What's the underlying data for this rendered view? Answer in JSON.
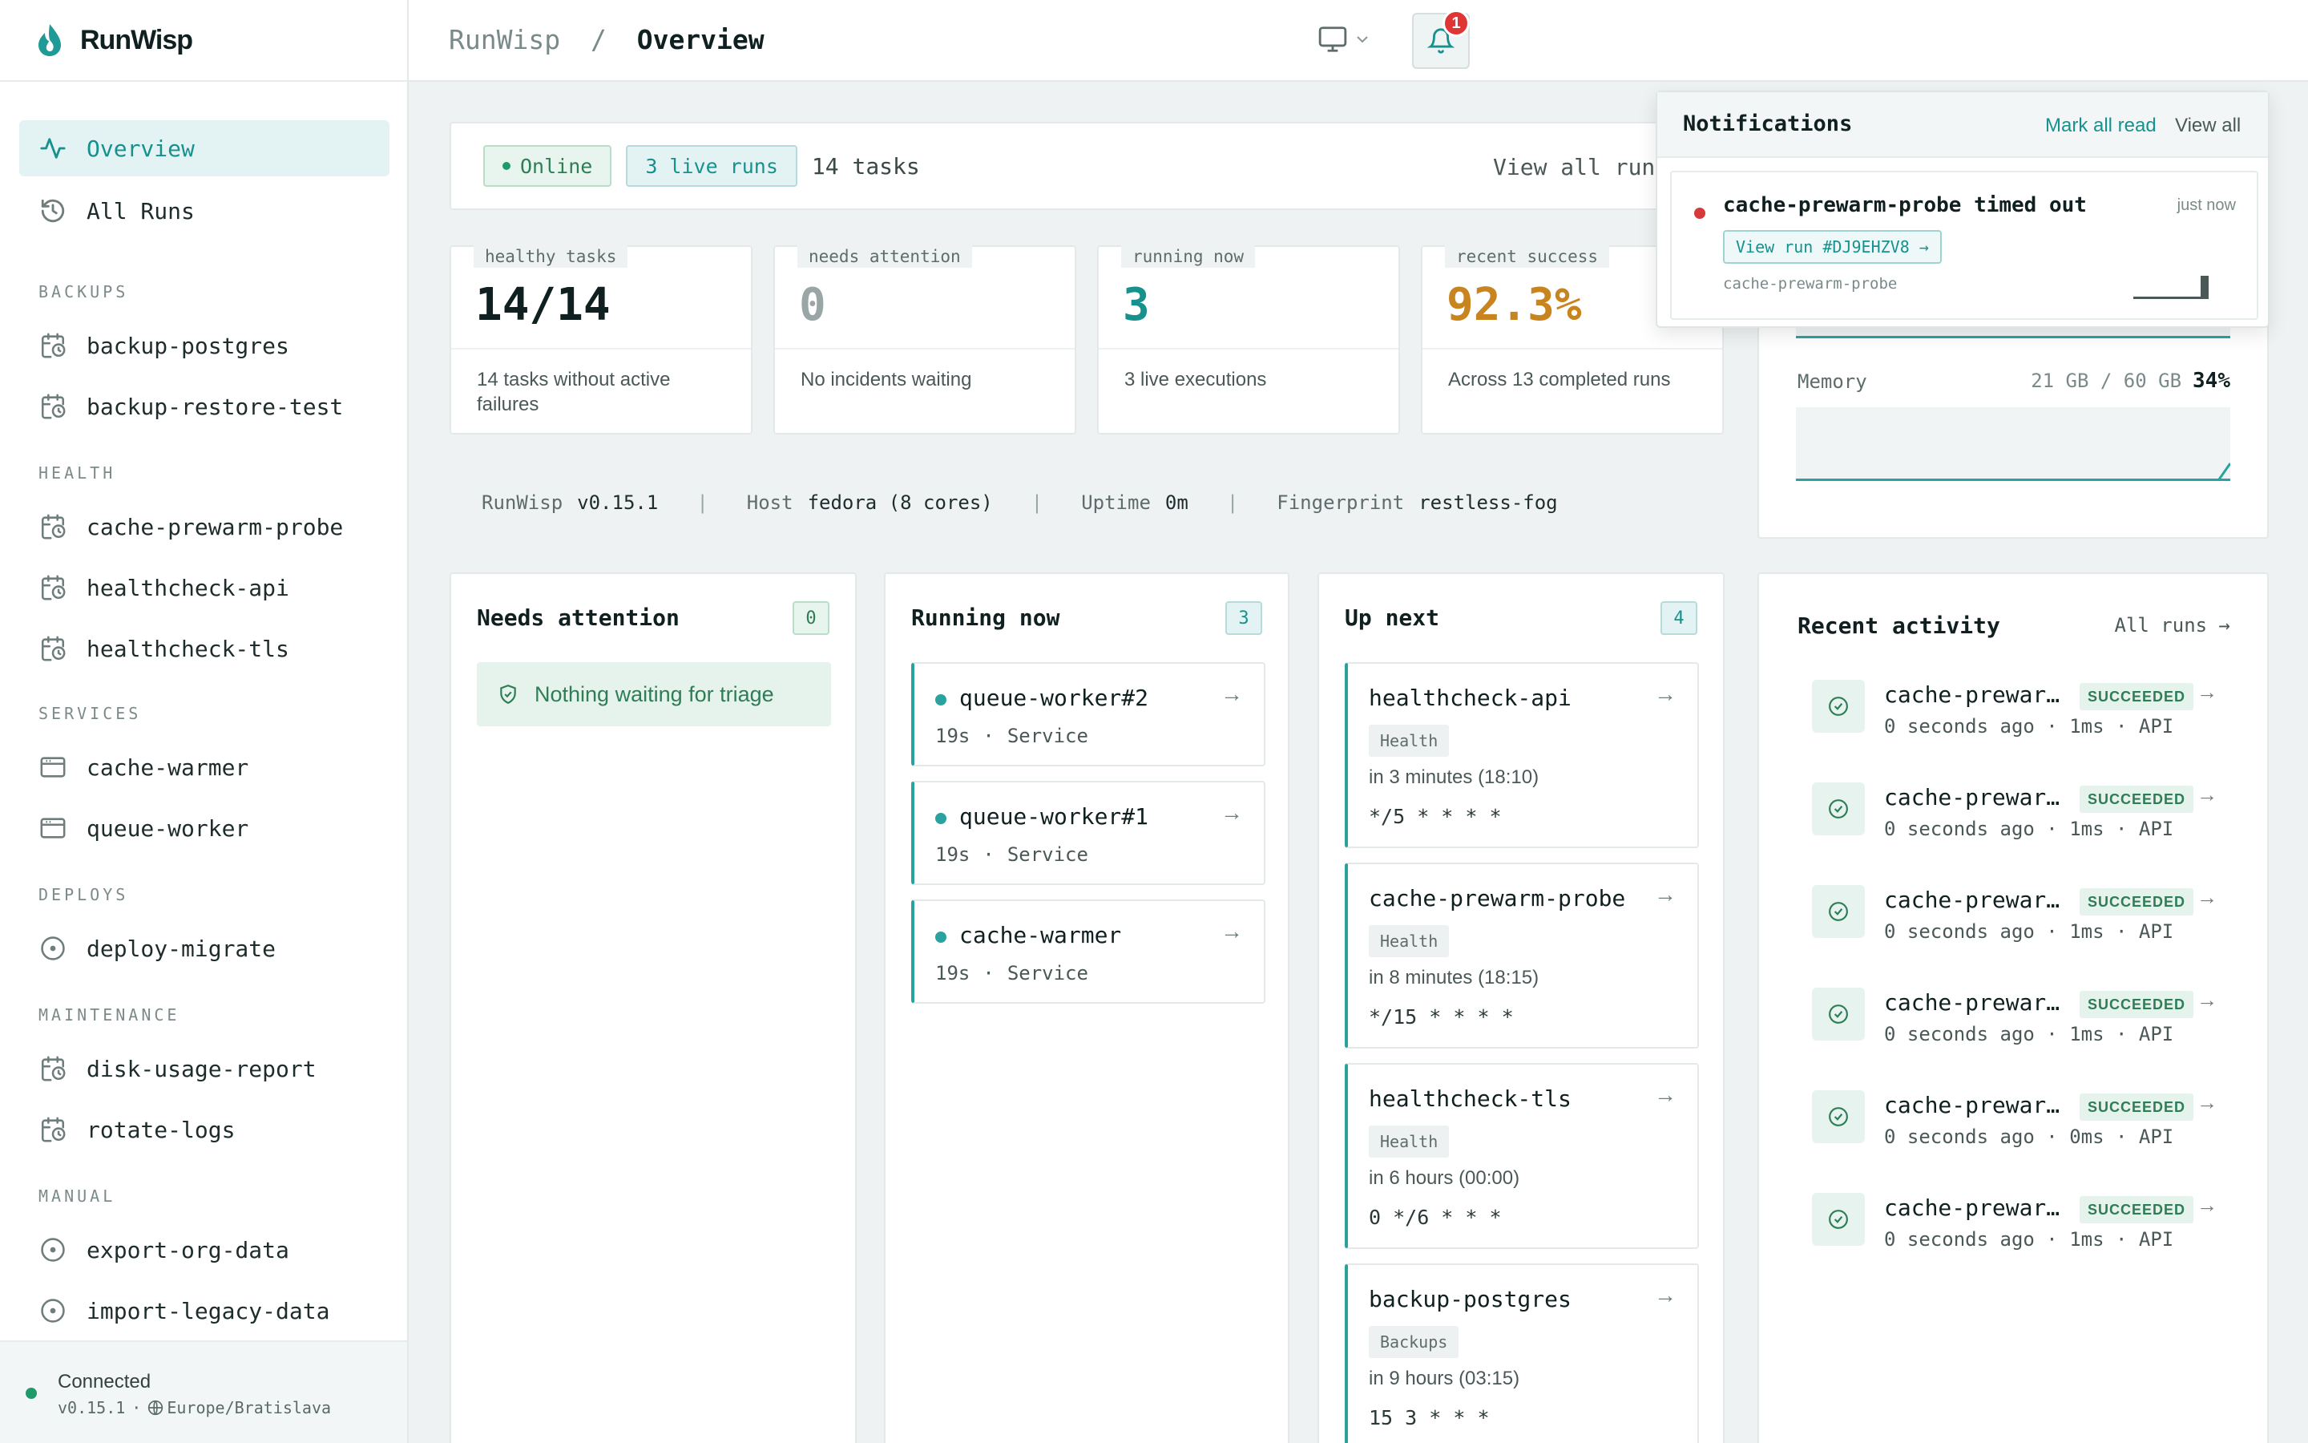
{
  "brand": {
    "name": "RunWisp"
  },
  "breadcrumb": {
    "root": "RunWisp",
    "sep": "/",
    "current": "Overview"
  },
  "sidebar": {
    "nav": [
      {
        "label": "Overview",
        "icon": "activity-icon",
        "active": true
      },
      {
        "label": "All Runs",
        "icon": "history-icon",
        "active": false
      }
    ],
    "groups": [
      {
        "title": "BACKUPS",
        "items": [
          {
            "label": "backup-postgres",
            "icon": "calendar-clock-icon"
          },
          {
            "label": "backup-restore-test",
            "icon": "calendar-clock-icon"
          }
        ]
      },
      {
        "title": "HEALTH",
        "items": [
          {
            "label": "cache-prewarm-probe",
            "icon": "calendar-clock-icon"
          },
          {
            "label": "healthcheck-api",
            "icon": "calendar-clock-icon"
          },
          {
            "label": "healthcheck-tls",
            "icon": "calendar-clock-icon"
          }
        ]
      },
      {
        "title": "SERVICES",
        "items": [
          {
            "label": "cache-warmer",
            "icon": "window-icon"
          },
          {
            "label": "queue-worker",
            "icon": "window-icon"
          }
        ]
      },
      {
        "title": "DEPLOYS",
        "items": [
          {
            "label": "deploy-migrate",
            "icon": "circle-dot-icon"
          }
        ]
      },
      {
        "title": "MAINTENANCE",
        "items": [
          {
            "label": "disk-usage-report",
            "icon": "calendar-clock-icon"
          },
          {
            "label": "rotate-logs",
            "icon": "calendar-clock-icon"
          }
        ]
      },
      {
        "title": "MANUAL",
        "items": [
          {
            "label": "export-org-data",
            "icon": "circle-dot-icon"
          },
          {
            "label": "import-legacy-data",
            "icon": "circle-dot-icon"
          }
        ]
      }
    ],
    "footer": {
      "status": "Connected",
      "version": "v0.15.1",
      "sep": "·",
      "timezone": "Europe/Bratislava"
    }
  },
  "topbar": {
    "notification_count": "1"
  },
  "statusbar": {
    "online": "Online",
    "live_runs": "3 live runs",
    "tasks": "14 tasks",
    "view_all": "View all runs"
  },
  "stats": [
    {
      "label": "healthy tasks",
      "value": "14/14",
      "desc": "14 tasks without active failures",
      "color": "#102020"
    },
    {
      "label": "needs attention",
      "value": "0",
      "desc": "No incidents waiting",
      "color": "#9aa6a6"
    },
    {
      "label": "running now",
      "value": "3",
      "desc": "3 live executions",
      "color": "#17918e"
    },
    {
      "label": "recent success",
      "value": "92.3%",
      "desc": "Across 13 completed runs",
      "color": "#c8841e"
    }
  ],
  "sysinfo": {
    "app": "RunWisp",
    "version": "v0.15.1",
    "host_label": "Host",
    "host": "fedora (8 cores)",
    "uptime_label": "Uptime",
    "uptime": "0m",
    "fp_label": "Fingerprint",
    "fingerprint": "restless-fog",
    "sep": "|"
  },
  "resources": {
    "memory_label": "Memory",
    "memory_used": "21 GB / 60 GB",
    "memory_pct": "34%",
    "memory_fraction": 0.34
  },
  "attention": {
    "title": "Needs attention",
    "count": "0",
    "empty": "Nothing waiting for triage"
  },
  "running": {
    "title": "Running now",
    "count": "3",
    "items": [
      {
        "name": "queue-worker#2",
        "duration": "19s",
        "sep": "·",
        "kind": "Service"
      },
      {
        "name": "queue-worker#1",
        "duration": "19s",
        "sep": "·",
        "kind": "Service"
      },
      {
        "name": "cache-warmer",
        "duration": "19s",
        "sep": "·",
        "kind": "Service"
      }
    ]
  },
  "upnext": {
    "title": "Up next",
    "count": "4",
    "items": [
      {
        "name": "healthcheck-api",
        "tag": "Health",
        "when": "in 3 minutes (18:10)",
        "cron": "*/5 * * * *"
      },
      {
        "name": "cache-prewarm-probe",
        "tag": "Health",
        "when": "in 8 minutes (18:15)",
        "cron": "*/15 * * * *"
      },
      {
        "name": "healthcheck-tls",
        "tag": "Health",
        "when": "in 6 hours (00:00)",
        "cron": "0 */6 * * *"
      },
      {
        "name": "backup-postgres",
        "tag": "Backups",
        "when": "in 9 hours (03:15)",
        "cron": "15 3 * * *"
      }
    ]
  },
  "recent": {
    "title": "Recent activity",
    "all_runs": "All runs →",
    "items": [
      {
        "name": "cache-prewarm-probe",
        "status": "SUCCEEDED",
        "meta": "0 seconds ago · 1ms · API"
      },
      {
        "name": "cache-prewarm-probe",
        "status": "SUCCEEDED",
        "meta": "0 seconds ago · 1ms · API"
      },
      {
        "name": "cache-prewarm-probe",
        "status": "SUCCEEDED",
        "meta": "0 seconds ago · 1ms · API"
      },
      {
        "name": "cache-prewarm-probe",
        "status": "SUCCEEDED",
        "meta": "0 seconds ago · 1ms · API"
      },
      {
        "name": "cache-prewarm-probe",
        "status": "SUCCEEDED",
        "meta": "0 seconds ago · 0ms · API"
      },
      {
        "name": "cache-prewarm-probe",
        "status": "SUCCEEDED",
        "meta": "0 seconds ago · 1ms · API"
      }
    ]
  },
  "notifications": {
    "title": "Notifications",
    "mark_all": "Mark all read",
    "view_all": "View all",
    "item": {
      "title": "cache-prewarm-probe timed out",
      "time": "just now",
      "link": "View run #DJ9EHZV8 →",
      "source": "cache-prewarm-probe"
    }
  },
  "colors": {
    "accent": "#17918e",
    "success": "#2e7d55",
    "warning": "#c8841e",
    "danger": "#d63a3a"
  }
}
